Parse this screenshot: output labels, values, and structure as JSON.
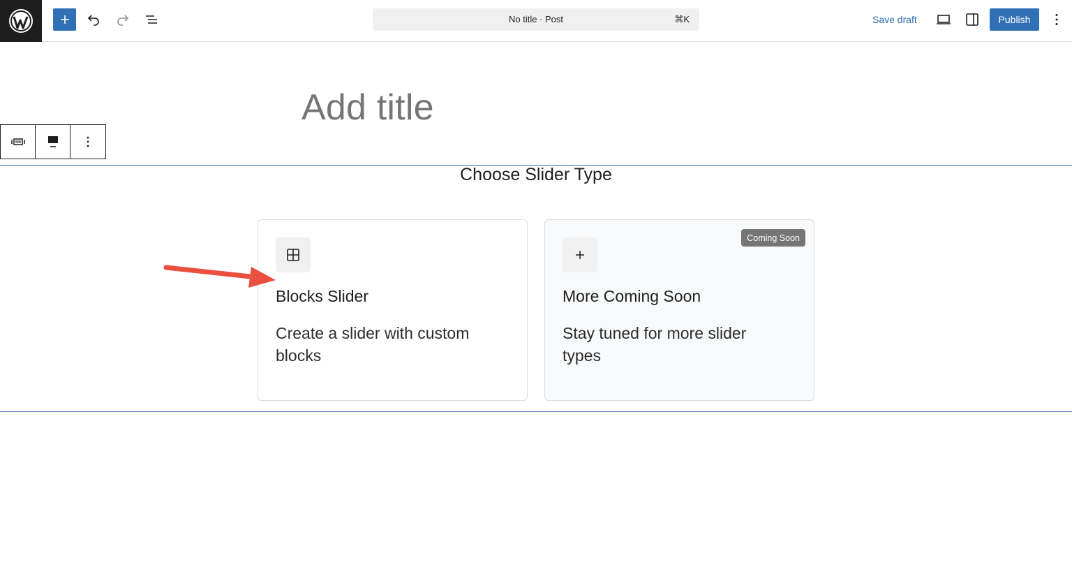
{
  "topbar": {
    "document_title": "No title · Post",
    "shortcut": "⌘K",
    "save_draft_label": "Save draft",
    "publish_label": "Publish",
    "icons": [
      "wordpress-logo",
      "plus",
      "undo",
      "redo",
      "list-view",
      "desktop-preview",
      "settings-sidebar",
      "more-options"
    ]
  },
  "editor": {
    "title_placeholder": "Add title",
    "block_toolbar_icons": [
      "slider-block-icon",
      "alignment-icon",
      "more-options-icon"
    ]
  },
  "slider_block": {
    "heading": "Choose Slider Type",
    "cards": [
      {
        "icon": "grid-icon",
        "title": "Blocks Slider",
        "description": "Create a slider with custom blocks"
      },
      {
        "icon": "plus-icon",
        "title": "More Coming Soon",
        "description": "Stay tuned for more slider types",
        "badge": "Coming Soon"
      }
    ]
  },
  "colors": {
    "accent": "#3071b5",
    "annotation_arrow": "#e9503f",
    "block_outline": "#3b6db5"
  }
}
